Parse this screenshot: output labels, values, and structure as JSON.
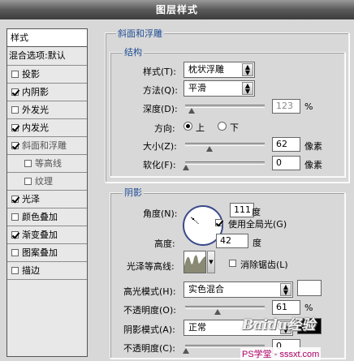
{
  "window": {
    "title": "图层样式"
  },
  "sidebar": {
    "header": "样式",
    "blend": "混合选项:默认",
    "items": [
      {
        "label": "投影",
        "checked": false,
        "indent": false
      },
      {
        "label": "内阴影",
        "checked": true,
        "indent": false
      },
      {
        "label": "外发光",
        "checked": false,
        "indent": false
      },
      {
        "label": "内发光",
        "checked": true,
        "indent": false
      },
      {
        "label": "斜面和浮雕",
        "checked": true,
        "indent": false
      },
      {
        "label": "等高线",
        "checked": false,
        "indent": true
      },
      {
        "label": "纹理",
        "checked": false,
        "indent": true
      },
      {
        "label": "光泽",
        "checked": true,
        "indent": false
      },
      {
        "label": "颜色叠加",
        "checked": false,
        "indent": false
      },
      {
        "label": "渐变叠加",
        "checked": true,
        "indent": false
      },
      {
        "label": "图案叠加",
        "checked": false,
        "indent": false
      },
      {
        "label": "描边",
        "checked": false,
        "indent": false
      }
    ]
  },
  "bevel": {
    "group_title": "斜面和浮雕",
    "structure": {
      "title": "结构",
      "style_label": "样式(T):",
      "style_value": "枕状浮雕",
      "technique_label": "方法(Q):",
      "technique_value": "平滑",
      "depth_label": "深度(D):",
      "depth_value": "123",
      "depth_unit": "%",
      "direction_label": "方向:",
      "dir_up": "上",
      "dir_down": "下",
      "size_label": "大小(Z):",
      "size_value": "62",
      "size_unit": "像素",
      "soften_label": "软化(F):",
      "soften_value": "0",
      "soften_unit": "像素"
    },
    "shading": {
      "title": "阴影",
      "angle_label": "角度(N):",
      "angle_value": "111",
      "angle_unit": "度",
      "global_light_label": "使用全局光(G)",
      "altitude_label": "高度:",
      "altitude_value": "42",
      "altitude_unit": "度",
      "gloss_label": "光泽等高线:",
      "antialias_label": "消除锯齿(L)",
      "highlight_mode_label": "高光模式(H):",
      "highlight_mode_value": "实色混合",
      "highlight_color": "#ffffff",
      "highlight_opacity_label": "不透明度(O):",
      "highlight_opacity_value": "61",
      "highlight_opacity_unit": "%",
      "shadow_mode_label": "阴影模式(A):",
      "shadow_mode_value": "正常",
      "shadow_color": "#000000",
      "shadow_opacity_label": "不透明度(C):",
      "shadow_opacity_value": "0"
    }
  },
  "watermark": {
    "logo": "Baidu经验",
    "site": "PS学堂 - sssxt.com"
  }
}
